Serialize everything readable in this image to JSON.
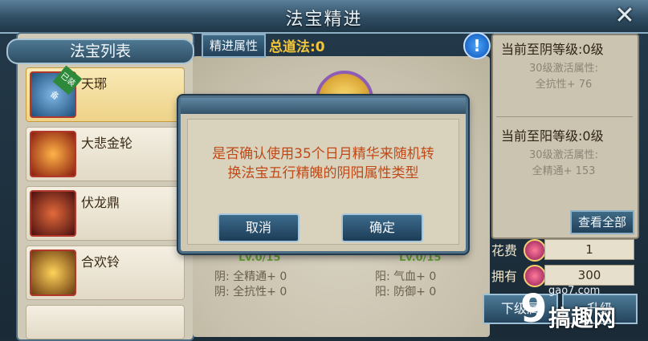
{
  "window": {
    "title": "法宝精进",
    "close_icon": "close-icon"
  },
  "list": {
    "header": "法宝列表",
    "items": [
      {
        "name": "天琊",
        "badge": "已装备",
        "selected": true
      },
      {
        "name": "大悲金轮"
      },
      {
        "name": "伏龙鼎"
      },
      {
        "name": "合欢铃"
      }
    ]
  },
  "main": {
    "attr_tab": "精进属性",
    "total_label": "总道法:0",
    "info_icon": "info-icon",
    "left_attr": {
      "level": "Lv.0/15",
      "attr1": "阴: 全精通+ 0",
      "attr2": "阴: 全抗性+ 0"
    },
    "right_attr": {
      "level": "Lv.0/15",
      "attr1": "阳: 气血+ 0",
      "attr2": "阳: 防御+ 0"
    }
  },
  "right_panel": {
    "yin_title": "当前至阴等级:0级",
    "yin_sub1": "30级激活属性:",
    "yin_sub2": "全抗性+ 76",
    "yang_title": "当前至阳等级:0级",
    "yang_sub1": "30级激活属性:",
    "yang_sub2": "全精通+ 153",
    "view_all": "查看全部"
  },
  "costs": {
    "cost_label": "花费",
    "cost_value": "1",
    "own_label": "拥有",
    "own_value": "300"
  },
  "bottom": {
    "next_level": "下级属",
    "upgrade": "升级"
  },
  "dialog": {
    "line1": "是否确认使用35个日月精华来随机转",
    "line2": "换法宝五行精魄的阴阳属性类型",
    "cancel": "取消",
    "confirm": "确定"
  },
  "watermark": {
    "domain": "gao7.com",
    "name": "搞趣网"
  }
}
